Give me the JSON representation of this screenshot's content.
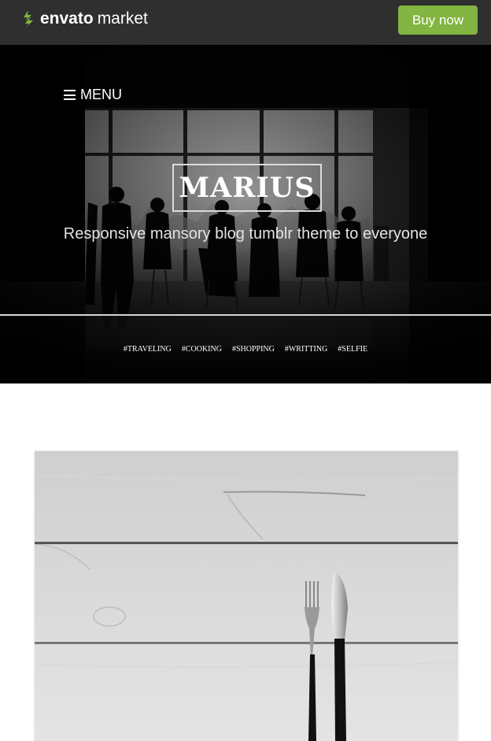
{
  "topbar": {
    "brand_bold": "envato",
    "brand_light": "market",
    "buy_label": "Buy now",
    "accent_color": "#82b541",
    "logo_icon": "envato-leaf-icon"
  },
  "hero": {
    "menu_label": "MENU",
    "site_title": "MARIUS",
    "tagline": "Responsive mansory blog tumblr theme to everyone",
    "tags": [
      "#TRAVELING",
      "#COOKING",
      "#SHOPPING",
      "#WRITTING",
      "#SELFIE"
    ]
  },
  "post": {
    "image": "fork-and-knife-on-wooden-table"
  }
}
